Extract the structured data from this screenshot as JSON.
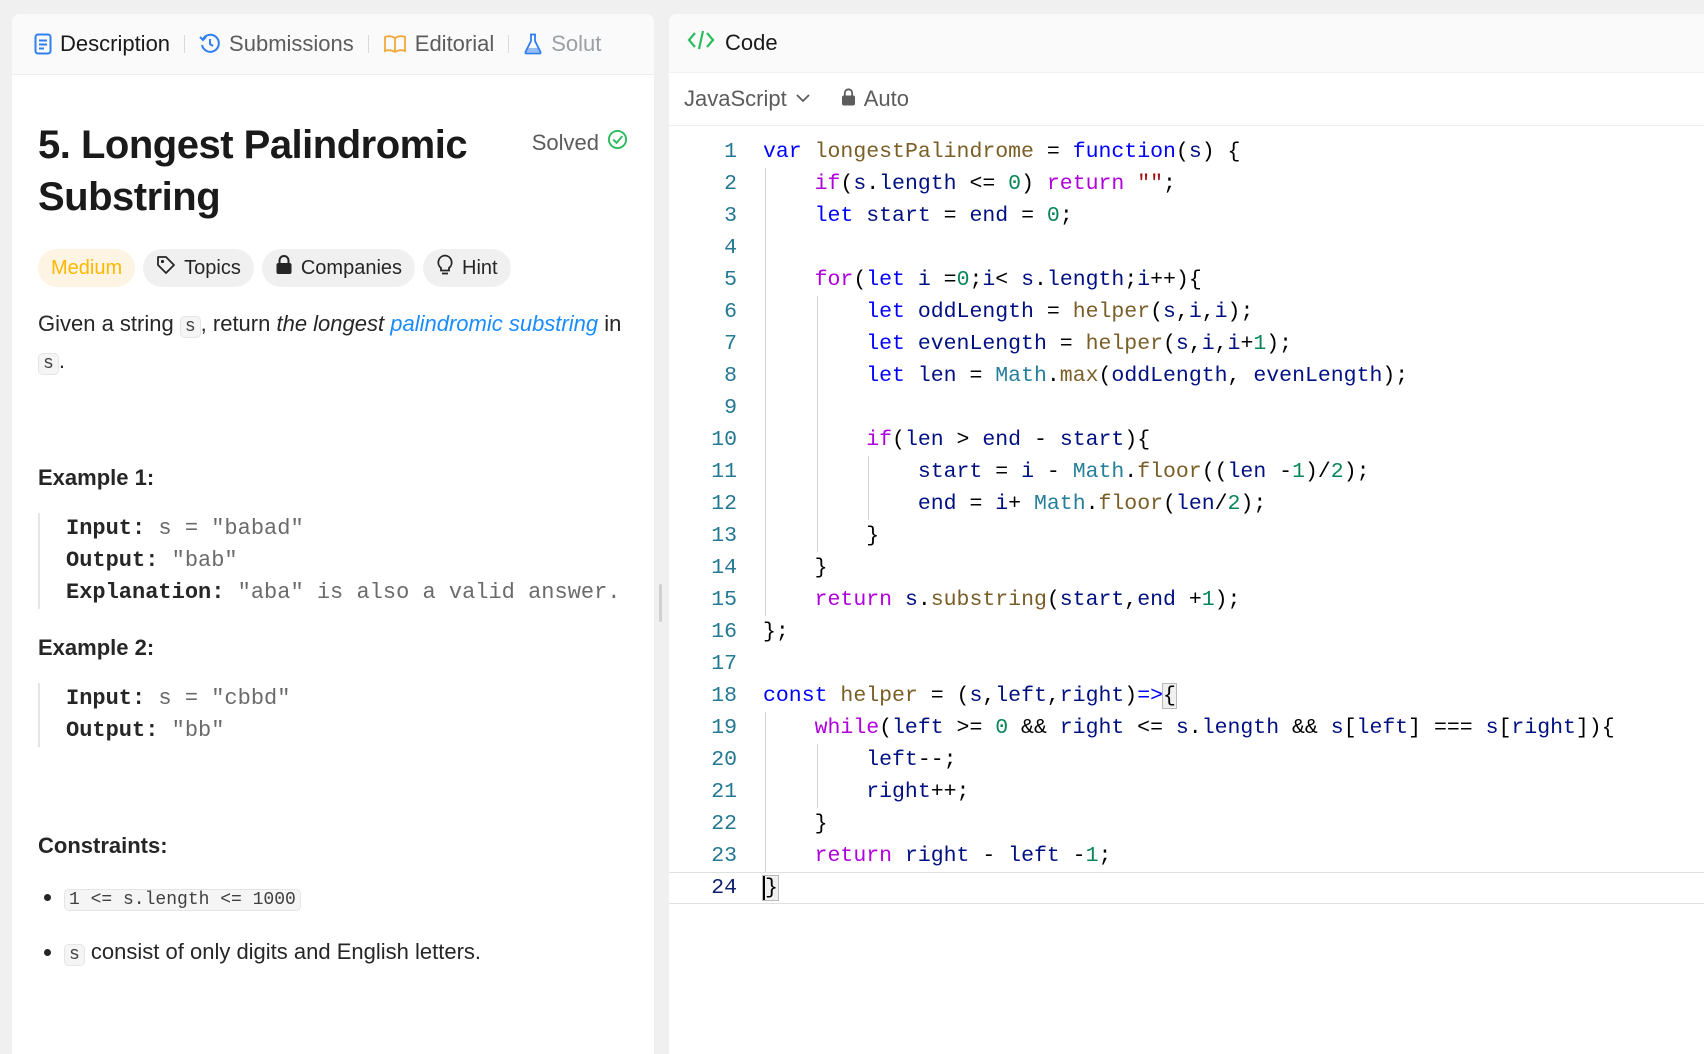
{
  "tabs": [
    "Description",
    "Submissions",
    "Editorial",
    "Solut"
  ],
  "problem": {
    "title": "5. Longest Palindromic Substring",
    "status": "Solved",
    "difficulty": "Medium",
    "tags": [
      "Topics",
      "Companies",
      "Hint"
    ],
    "desc_parts": [
      "Given a string ",
      "s",
      ", return ",
      "the longest",
      "palindromic substring",
      " in ",
      "s",
      "."
    ],
    "examples": [
      {
        "title": "Example 1:",
        "input_label": "Input:",
        "input": " s = \"babad\"",
        "output_label": "Output:",
        "output": " \"bab\"",
        "explanation_label": "Explanation:",
        "explanation": " \"aba\" is also a valid answer."
      },
      {
        "title": "Example 2:",
        "input_label": "Input:",
        "input": " s = \"cbbd\"",
        "output_label": "Output:",
        "output": " \"bb\""
      }
    ],
    "constraints_title": "Constraints:",
    "constraints": [
      "1 <= s.length <= 1000",
      "s",
      " consist of only digits and English letters."
    ]
  },
  "code_panel": {
    "header": "Code",
    "language": "JavaScript",
    "mode": "Auto",
    "line_numbers": [
      "1",
      "2",
      "3",
      "4",
      "5",
      "6",
      "7",
      "8",
      "9",
      "10",
      "11",
      "12",
      "13",
      "14",
      "15",
      "16",
      "17",
      "18",
      "19",
      "20",
      "21",
      "22",
      "23",
      "24"
    ],
    "lines": [
      "var longestPalindrome = function(s) {",
      "    if(s.length <= 0) return \"\";",
      "    let start = end = 0;",
      "",
      "    for(let i =0;i< s.length;i++){",
      "        let oddLength = helper(s,i,i);",
      "        let evenLength = helper(s,i,i+1);",
      "        let len = Math.max(oddLength, evenLength);",
      "",
      "        if(len > end - start){",
      "            start = i - Math.floor((len -1)/2);",
      "            end = i+ Math.floor(len/2);",
      "        }",
      "    }",
      "    return s.substring(start,end +1);",
      "};",
      "",
      "const helper = (s,left,right)=>{",
      "    while(left >= 0 && right <= s.length && s[left] === s[right]){",
      "        left--;",
      "        right++;",
      "    }",
      "    return right - left -1;",
      "}"
    ]
  }
}
